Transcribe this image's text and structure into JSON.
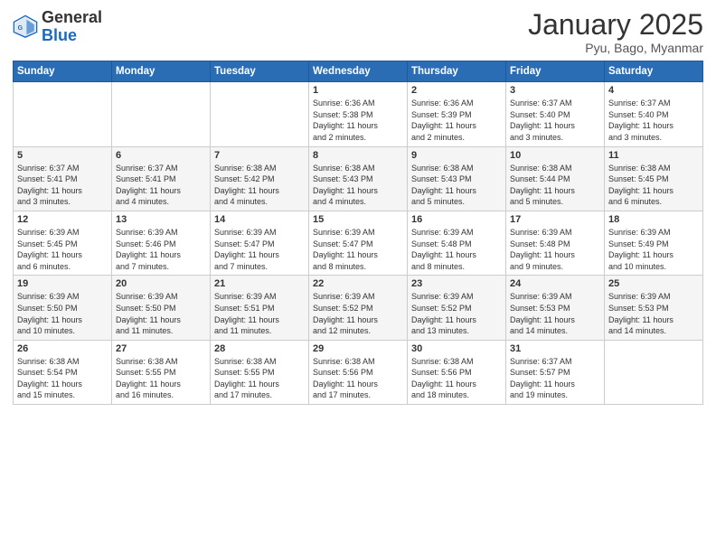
{
  "header": {
    "logo_general": "General",
    "logo_blue": "Blue",
    "month": "January 2025",
    "location": "Pyu, Bago, Myanmar"
  },
  "days_of_week": [
    "Sunday",
    "Monday",
    "Tuesday",
    "Wednesday",
    "Thursday",
    "Friday",
    "Saturday"
  ],
  "weeks": [
    [
      {
        "day": "",
        "info": ""
      },
      {
        "day": "",
        "info": ""
      },
      {
        "day": "",
        "info": ""
      },
      {
        "day": "1",
        "info": "Sunrise: 6:36 AM\nSunset: 5:38 PM\nDaylight: 11 hours\nand 2 minutes."
      },
      {
        "day": "2",
        "info": "Sunrise: 6:36 AM\nSunset: 5:39 PM\nDaylight: 11 hours\nand 2 minutes."
      },
      {
        "day": "3",
        "info": "Sunrise: 6:37 AM\nSunset: 5:40 PM\nDaylight: 11 hours\nand 3 minutes."
      },
      {
        "day": "4",
        "info": "Sunrise: 6:37 AM\nSunset: 5:40 PM\nDaylight: 11 hours\nand 3 minutes."
      }
    ],
    [
      {
        "day": "5",
        "info": "Sunrise: 6:37 AM\nSunset: 5:41 PM\nDaylight: 11 hours\nand 3 minutes."
      },
      {
        "day": "6",
        "info": "Sunrise: 6:37 AM\nSunset: 5:41 PM\nDaylight: 11 hours\nand 4 minutes."
      },
      {
        "day": "7",
        "info": "Sunrise: 6:38 AM\nSunset: 5:42 PM\nDaylight: 11 hours\nand 4 minutes."
      },
      {
        "day": "8",
        "info": "Sunrise: 6:38 AM\nSunset: 5:43 PM\nDaylight: 11 hours\nand 4 minutes."
      },
      {
        "day": "9",
        "info": "Sunrise: 6:38 AM\nSunset: 5:43 PM\nDaylight: 11 hours\nand 5 minutes."
      },
      {
        "day": "10",
        "info": "Sunrise: 6:38 AM\nSunset: 5:44 PM\nDaylight: 11 hours\nand 5 minutes."
      },
      {
        "day": "11",
        "info": "Sunrise: 6:38 AM\nSunset: 5:45 PM\nDaylight: 11 hours\nand 6 minutes."
      }
    ],
    [
      {
        "day": "12",
        "info": "Sunrise: 6:39 AM\nSunset: 5:45 PM\nDaylight: 11 hours\nand 6 minutes."
      },
      {
        "day": "13",
        "info": "Sunrise: 6:39 AM\nSunset: 5:46 PM\nDaylight: 11 hours\nand 7 minutes."
      },
      {
        "day": "14",
        "info": "Sunrise: 6:39 AM\nSunset: 5:47 PM\nDaylight: 11 hours\nand 7 minutes."
      },
      {
        "day": "15",
        "info": "Sunrise: 6:39 AM\nSunset: 5:47 PM\nDaylight: 11 hours\nand 8 minutes."
      },
      {
        "day": "16",
        "info": "Sunrise: 6:39 AM\nSunset: 5:48 PM\nDaylight: 11 hours\nand 8 minutes."
      },
      {
        "day": "17",
        "info": "Sunrise: 6:39 AM\nSunset: 5:48 PM\nDaylight: 11 hours\nand 9 minutes."
      },
      {
        "day": "18",
        "info": "Sunrise: 6:39 AM\nSunset: 5:49 PM\nDaylight: 11 hours\nand 10 minutes."
      }
    ],
    [
      {
        "day": "19",
        "info": "Sunrise: 6:39 AM\nSunset: 5:50 PM\nDaylight: 11 hours\nand 10 minutes."
      },
      {
        "day": "20",
        "info": "Sunrise: 6:39 AM\nSunset: 5:50 PM\nDaylight: 11 hours\nand 11 minutes."
      },
      {
        "day": "21",
        "info": "Sunrise: 6:39 AM\nSunset: 5:51 PM\nDaylight: 11 hours\nand 11 minutes."
      },
      {
        "day": "22",
        "info": "Sunrise: 6:39 AM\nSunset: 5:52 PM\nDaylight: 11 hours\nand 12 minutes."
      },
      {
        "day": "23",
        "info": "Sunrise: 6:39 AM\nSunset: 5:52 PM\nDaylight: 11 hours\nand 13 minutes."
      },
      {
        "day": "24",
        "info": "Sunrise: 6:39 AM\nSunset: 5:53 PM\nDaylight: 11 hours\nand 14 minutes."
      },
      {
        "day": "25",
        "info": "Sunrise: 6:39 AM\nSunset: 5:53 PM\nDaylight: 11 hours\nand 14 minutes."
      }
    ],
    [
      {
        "day": "26",
        "info": "Sunrise: 6:38 AM\nSunset: 5:54 PM\nDaylight: 11 hours\nand 15 minutes."
      },
      {
        "day": "27",
        "info": "Sunrise: 6:38 AM\nSunset: 5:55 PM\nDaylight: 11 hours\nand 16 minutes."
      },
      {
        "day": "28",
        "info": "Sunrise: 6:38 AM\nSunset: 5:55 PM\nDaylight: 11 hours\nand 17 minutes."
      },
      {
        "day": "29",
        "info": "Sunrise: 6:38 AM\nSunset: 5:56 PM\nDaylight: 11 hours\nand 17 minutes."
      },
      {
        "day": "30",
        "info": "Sunrise: 6:38 AM\nSunset: 5:56 PM\nDaylight: 11 hours\nand 18 minutes."
      },
      {
        "day": "31",
        "info": "Sunrise: 6:37 AM\nSunset: 5:57 PM\nDaylight: 11 hours\nand 19 minutes."
      },
      {
        "day": "",
        "info": ""
      }
    ]
  ]
}
